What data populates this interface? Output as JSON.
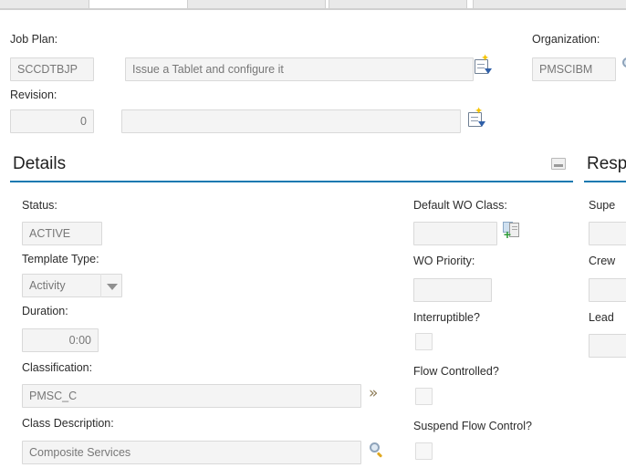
{
  "tabstrip": {
    "tabs": [
      {
        "name": "tab-1",
        "label": ""
      },
      {
        "name": "tab-2",
        "label": ""
      },
      {
        "name": "tab-3",
        "label": ""
      },
      {
        "name": "tab-4",
        "label": ""
      }
    ]
  },
  "header": {
    "jobplan_label": "Job Plan:",
    "jobplan_id": "SCCDTBJP",
    "jobplan_description": "Issue a Tablet and configure it",
    "revision_label": "Revision:",
    "revision_value": "0",
    "revision_description": "",
    "organization_label": "Organization:",
    "organization_value": "PMSCIBM"
  },
  "details": {
    "title": "Details",
    "left": {
      "status_label": "Status:",
      "status_value": "ACTIVE",
      "template_type_label": "Template Type:",
      "template_type_value": "Activity",
      "duration_label": "Duration:",
      "duration_value": "0:00",
      "classification_label": "Classification:",
      "classification_value": "PMSC_C",
      "class_description_label": "Class Description:",
      "class_description_value": "Composite Services"
    },
    "middle": {
      "default_wo_class_label": "Default WO Class:",
      "default_wo_class_value": "",
      "wo_priority_label": "WO Priority:",
      "wo_priority_value": "",
      "interruptible_label": "Interruptible?",
      "flow_controlled_label": "Flow Controlled?",
      "suspend_flow_control_label": "Suspend Flow Control?"
    }
  },
  "responsibility": {
    "title": "Resp",
    "supervisor_label": "Supe",
    "supervisor_value": "",
    "crew_label": "Crew",
    "crew_value": "",
    "lead_label": "Lead",
    "lead_value": ""
  },
  "colors": {
    "section_rule": "#1479b0",
    "field_background": "#f4f4f4",
    "field_border": "#d9d9d9",
    "label_text": "#2b2b2b",
    "value_text": "#777777"
  }
}
